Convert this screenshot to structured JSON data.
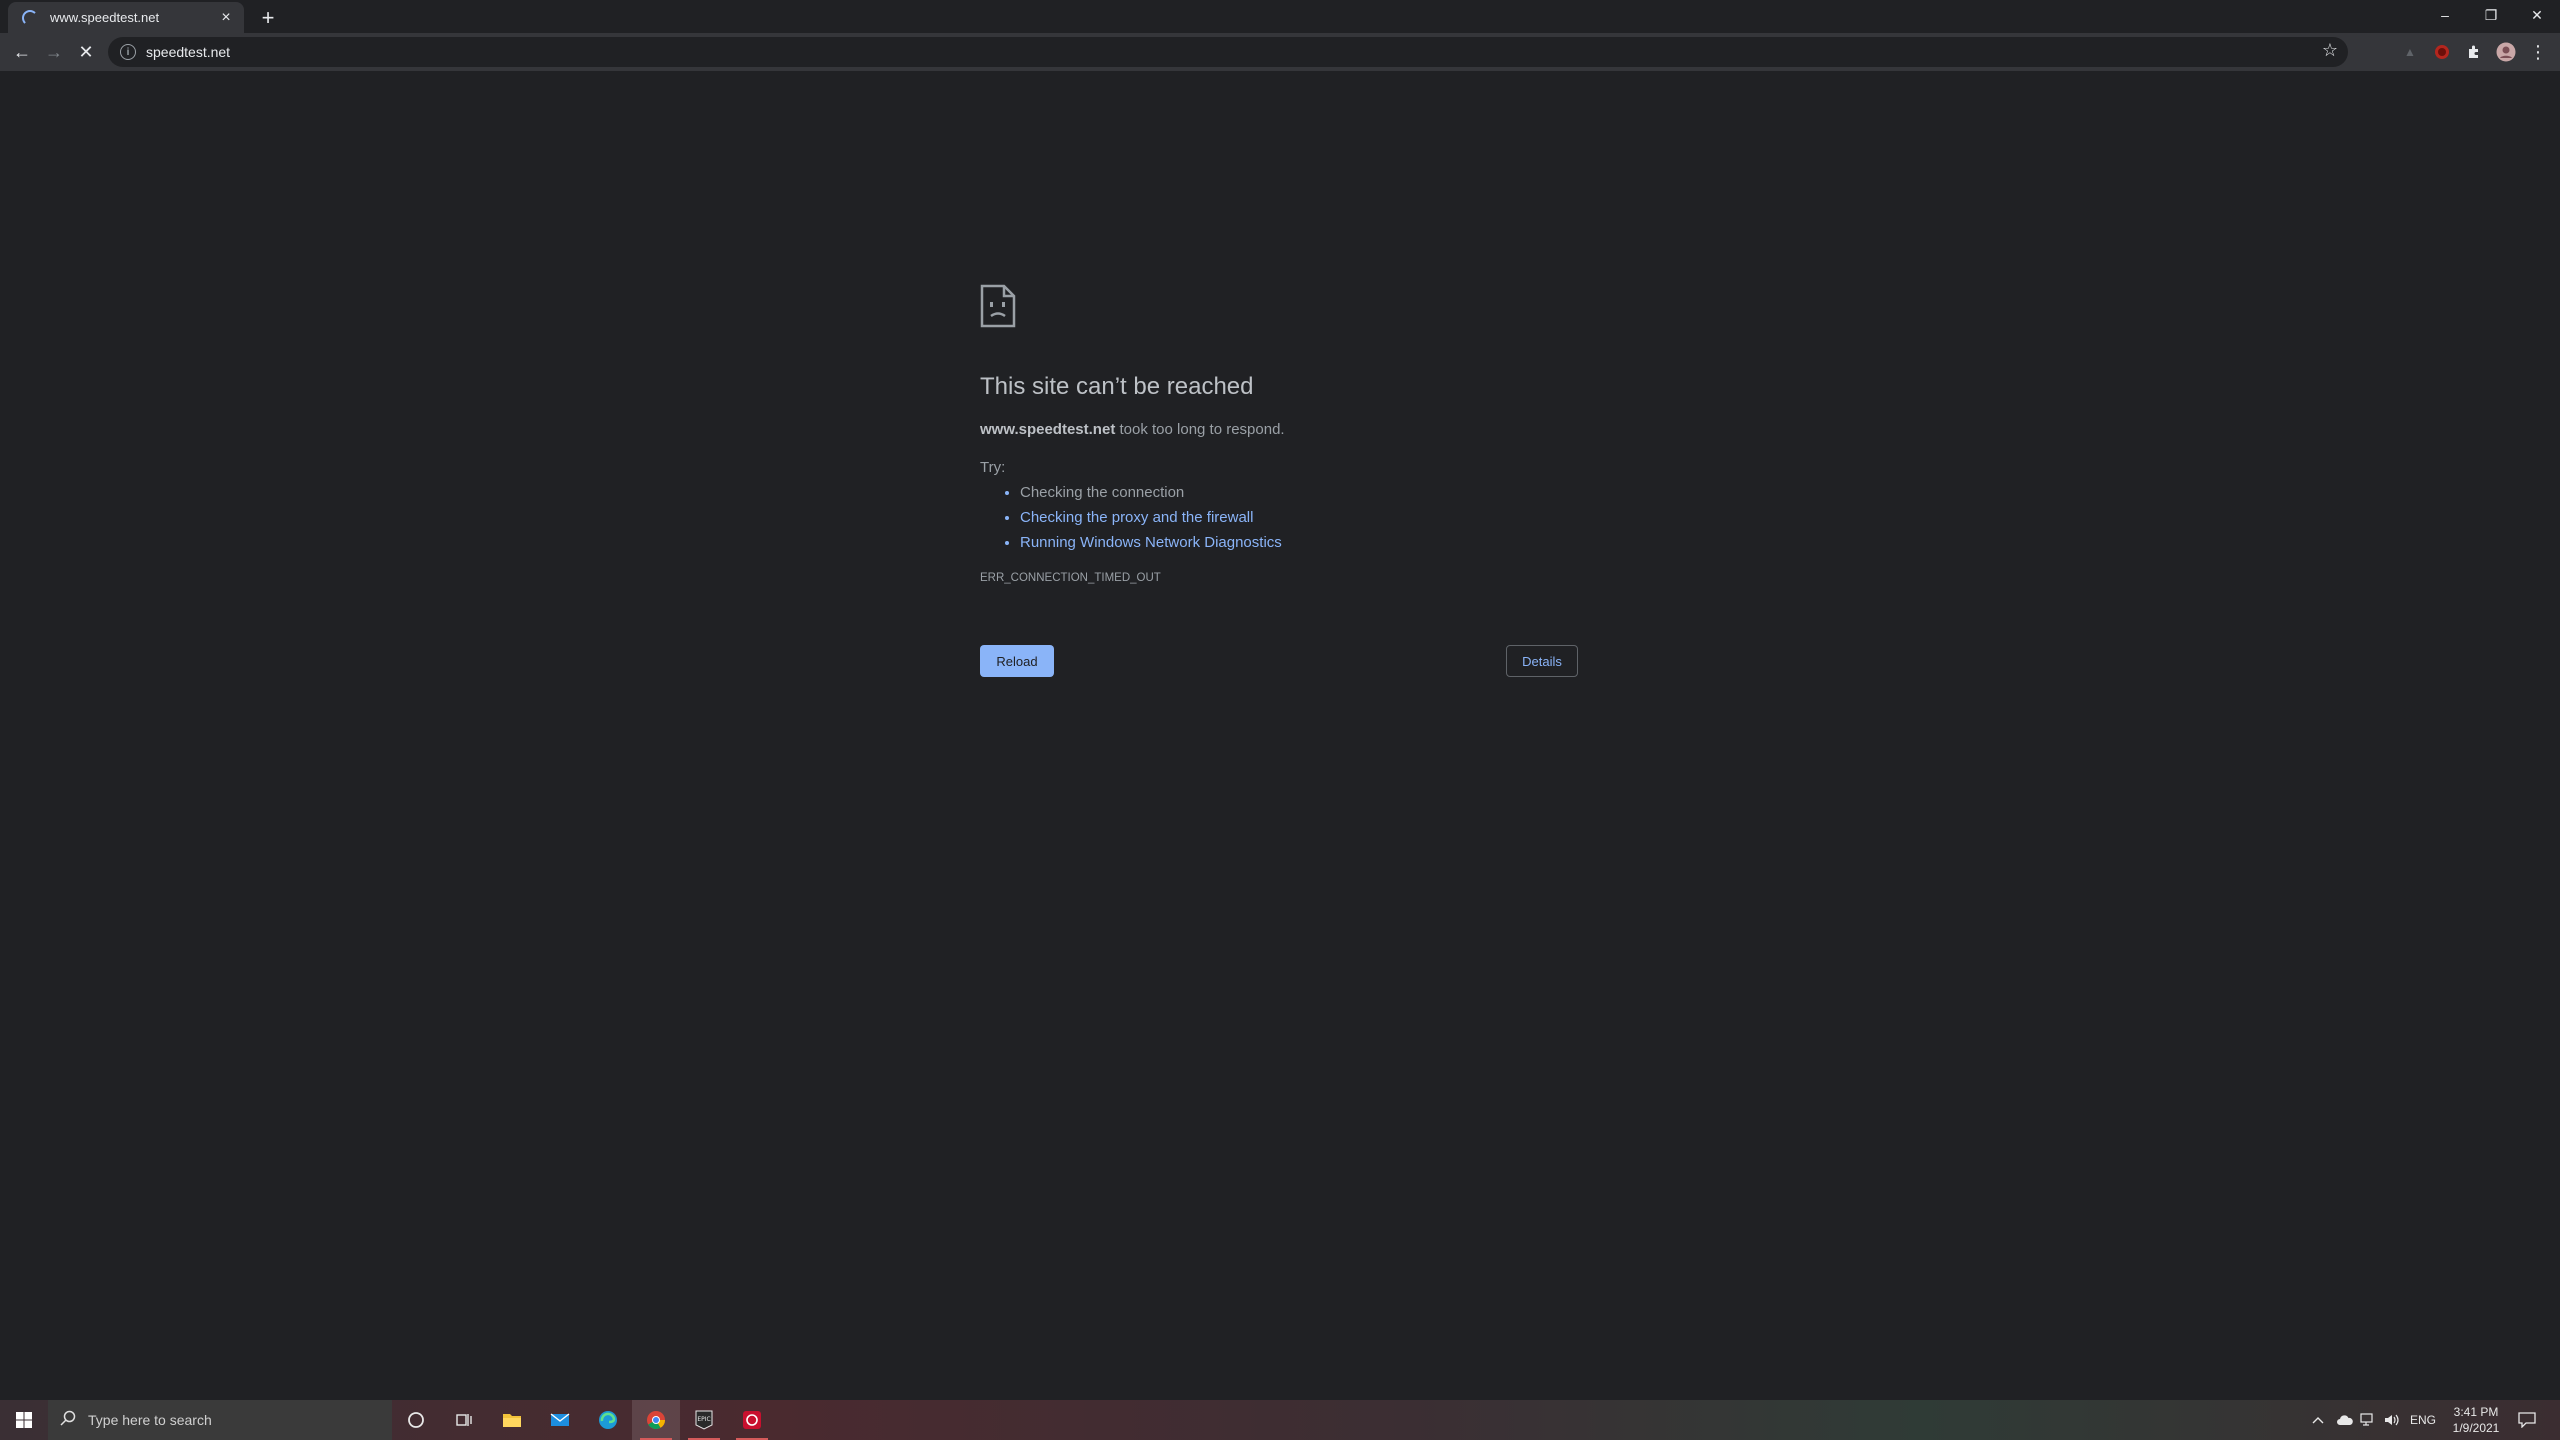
{
  "tab": {
    "title": "www.speedtest.net",
    "close_glyph": "×"
  },
  "newtab": {
    "glyph": "+"
  },
  "window_controls": {
    "minimize": "–",
    "restore": "❐",
    "close": "✕"
  },
  "toolbar": {
    "back": "←",
    "forward": "→",
    "stop": "✕",
    "star": "☆",
    "menu": "⋮"
  },
  "omnibox": {
    "info": "i",
    "url": "speedtest.net"
  },
  "error_page": {
    "heading": "This site can’t be reached",
    "host": "www.speedtest.net",
    "desc_rest": " took too long to respond.",
    "try_label": "Try:",
    "suggestions": [
      "Checking the connection",
      "Checking the proxy and the firewall",
      "Running Windows Network Diagnostics"
    ],
    "error_code": "ERR_CONNECTION_TIMED_OUT",
    "reload_label": "Reload",
    "details_label": "Details"
  },
  "taskbar": {
    "search_placeholder": "Type here to search",
    "language": "ENG",
    "time": "3:41 PM",
    "date": "1/9/2021"
  },
  "colors": {
    "page_bg": "#202124",
    "link": "#8ab4f8",
    "toolbar_bg": "#35363a"
  }
}
